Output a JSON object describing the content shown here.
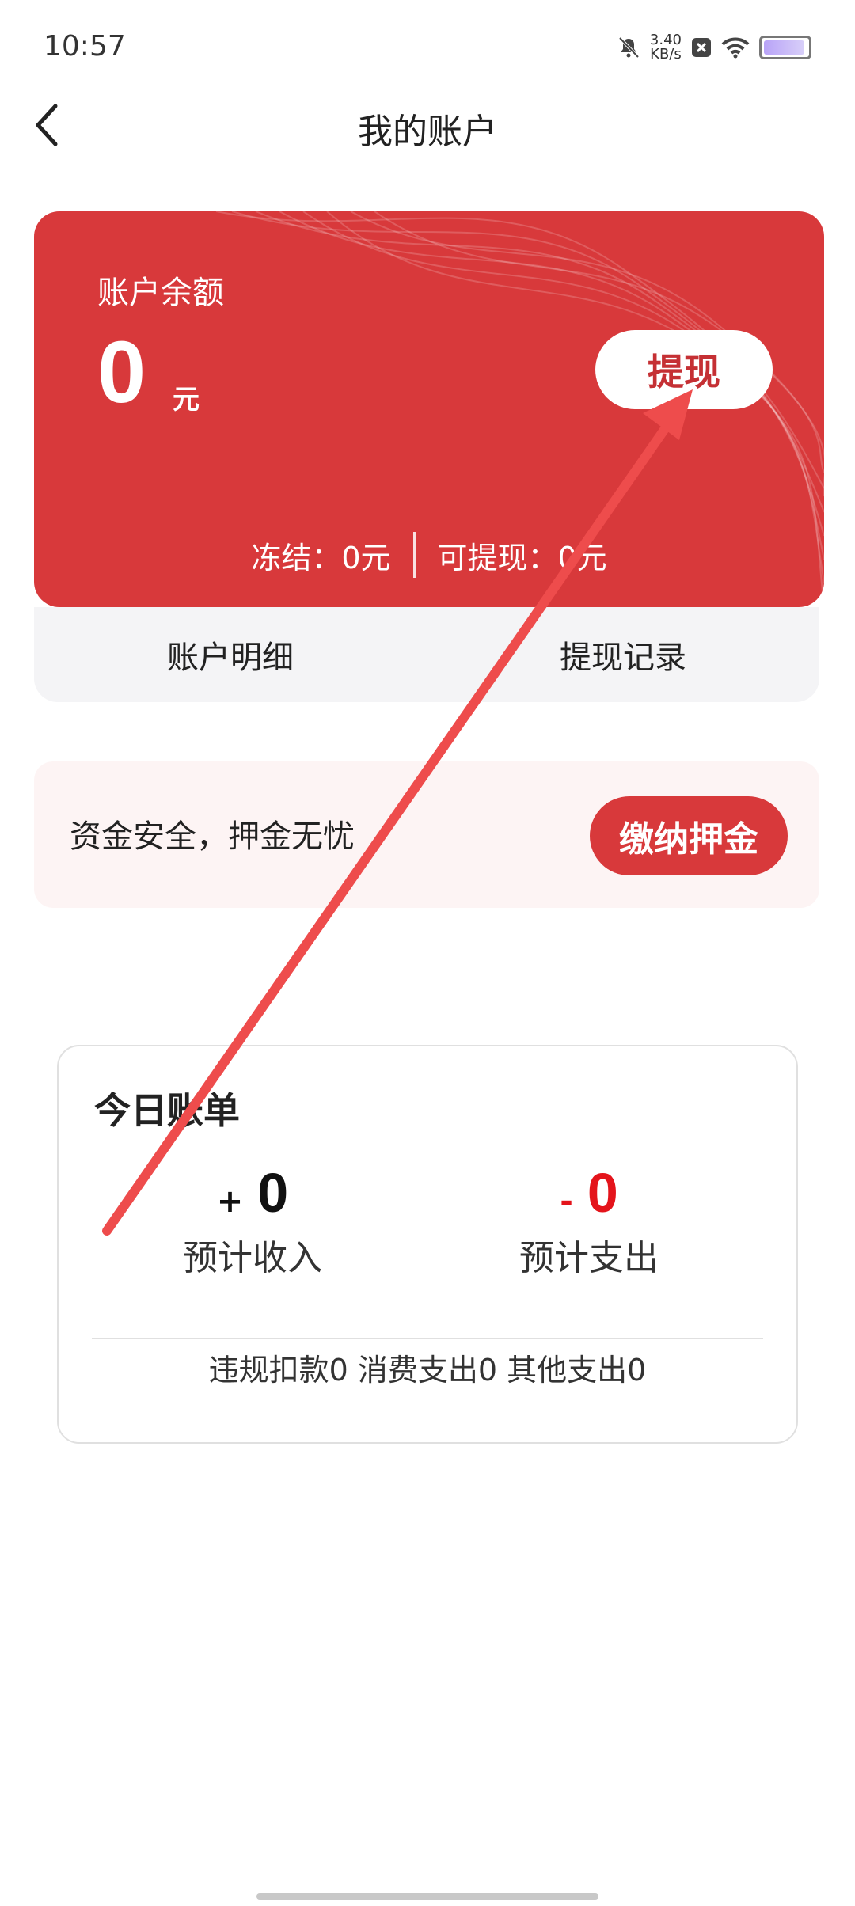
{
  "status_bar": {
    "time": "10:57",
    "speed_value": "3.40",
    "speed_unit": "KB/s"
  },
  "header": {
    "title": "我的账户"
  },
  "balance_card": {
    "label": "账户余额",
    "amount": "0",
    "unit": "元",
    "withdraw_label": "提现",
    "frozen_label": "冻结：0元",
    "withdrawable_label": "可提现：0元"
  },
  "tabs": {
    "detail": "账户明细",
    "records": "提现记录"
  },
  "deposit": {
    "text": "资金安全，押金无忧",
    "button": "缴纳押金"
  },
  "daily_bill": {
    "title": "今日账单",
    "income_sign": "+",
    "income_value": "0",
    "income_label": "预计收入",
    "expense_sign": "-",
    "expense_value": "0",
    "expense_label": "预计支出",
    "footer": "违规扣款0 消费支出0 其他支出0"
  },
  "colors": {
    "primary": "#d8393b",
    "expense": "#e4141b",
    "annotation": "#ee4c4c"
  }
}
